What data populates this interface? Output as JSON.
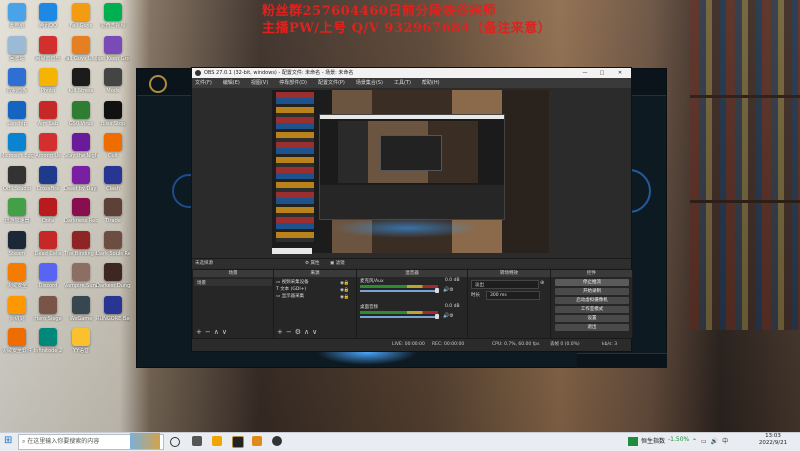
{
  "overlay_text": {
    "line1": "粉丝群257604460日前分段峡谷宗师",
    "line2": "主播PW/上号 Q/V 932967684（备注来意）"
  },
  "desktop_icons": [
    {
      "label": "此电脑",
      "color": "#4aa3e8"
    },
    {
      "label": "腾讯QQ",
      "color": "#1e88e5"
    },
    {
      "label": "Fall Guys",
      "color": "#f39c12"
    },
    {
      "label": "爱奇艺视频",
      "color": "#00b050"
    },
    {
      "label": "回收站",
      "color": "#9bbad6"
    },
    {
      "label": "网易云音乐",
      "color": "#d32f2f"
    },
    {
      "label": "Fall Guys Ultimate",
      "color": "#e67e22"
    },
    {
      "label": "Just Keep Growin",
      "color": "#7a4ab8"
    },
    {
      "label": "控制面板",
      "color": "#2e6fd1"
    },
    {
      "label": "Photo",
      "color": "#f4b400"
    },
    {
      "label": "Kill Stress",
      "color": "#1b1b1b"
    },
    {
      "label": "Mods",
      "color": "#444"
    },
    {
      "label": "Lanchip",
      "color": "#1565c0"
    },
    {
      "label": "Aim Lab",
      "color": "#c62828"
    },
    {
      "label": "GS0 Virus",
      "color": "#2e7d32"
    },
    {
      "label": "Bliss Stop",
      "color": "#111"
    },
    {
      "label": "Microsoft Edge",
      "color": "#0a84d0"
    },
    {
      "label": "Among Us",
      "color": "#d32f2f"
    },
    {
      "label": "Stay the Night",
      "color": "#6a1b9a"
    },
    {
      "label": "Cult",
      "color": "#ef6c00"
    },
    {
      "label": "OBS Studio",
      "color": "#333"
    },
    {
      "label": "CrossFire",
      "color": "#1e3a8a"
    },
    {
      "label": "Dead by Daylight",
      "color": "#7b1fa2"
    },
    {
      "label": "Clash",
      "color": "#283593"
    },
    {
      "label": "迅游加速器",
      "color": "#43a047"
    },
    {
      "label": "Dota",
      "color": "#b71c1c"
    },
    {
      "label": "Darkness Reborn",
      "color": "#880e4f"
    },
    {
      "label": "Tirade",
      "color": "#5d4037"
    },
    {
      "label": "Steam",
      "color": "#1b2838"
    },
    {
      "label": "Dead Cells",
      "color": "#c62828"
    },
    {
      "label": "The Binding of Isaac",
      "color": "#8e2424"
    },
    {
      "label": "Dark Souls Remastered",
      "color": "#6d4c41"
    },
    {
      "label": "火绒安全",
      "color": "#f57c00"
    },
    {
      "label": "Discord",
      "color": "#5865f2"
    },
    {
      "label": "Vampire Survivors",
      "color": "#8d6e63"
    },
    {
      "label": "Darkest Dungeon",
      "color": "#3e2723"
    },
    {
      "label": "火绒剑",
      "color": "#ff9800"
    },
    {
      "label": "Hero Siege",
      "color": "#795548"
    },
    {
      "label": "WeGame",
      "color": "#37474f"
    },
    {
      "label": "RUNGORE Beginner",
      "color": "#283593"
    },
    {
      "label": "火绒安全软件",
      "color": "#ef6c00"
    },
    {
      "label": "Infinitode 2",
      "color": "#00897b"
    },
    {
      "label": "YY语音",
      "color": "#fbc02d"
    }
  ],
  "obs": {
    "title": "OBS 27.0.1 (32-bit, windows) - 配置文件: 未命名 - 场景: 未命名",
    "menu": [
      "文件(F)",
      "编辑(E)",
      "视图(V)",
      "停靠部件(D)",
      "配置文件(P)",
      "场景集合(S)",
      "工具(T)",
      "帮助(H)"
    ],
    "no_source": "未选择源",
    "props_btn": "属性",
    "filters_btn": "滤镜",
    "panels": {
      "scenes": {
        "title": "场景",
        "items": [
          "场景"
        ]
      },
      "sources": {
        "title": "来源",
        "items": [
          "视频采集设备",
          "文本 (GDI+)",
          "显示器采集"
        ]
      },
      "mixer": {
        "title": "混音器",
        "channels": [
          {
            "name": "麦克风/Aux",
            "db": "0.0 dB"
          },
          {
            "name": "桌面音频",
            "db": "0.0 dB"
          }
        ]
      },
      "transitions": {
        "title": "转场特效",
        "type": "淡出",
        "duration_label": "时长",
        "duration": "300 ms"
      },
      "controls": {
        "title": "控件",
        "buttons": [
          "停止推流",
          "开始录制",
          "启动虚拟摄像机",
          "工作室模式",
          "设置",
          "退出"
        ]
      }
    },
    "status": {
      "live": "LIVE: 00:00:00",
      "rec": "REC: 00:00:00",
      "cpu": "CPU: 0.7%, 60.00 fps",
      "dropped": "丢帧 0 (0.0%)",
      "kbps": "kb/s: 3"
    }
  },
  "taskbar": {
    "search_placeholder": "在这里输入你要搜索的内容",
    "stock_name": "恒生指数",
    "stock_change": "-1.50%",
    "time": "13:03",
    "date": "2022/9/21"
  }
}
